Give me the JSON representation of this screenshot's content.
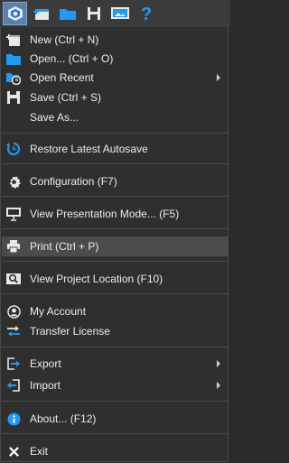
{
  "toolbar": {
    "buttons": [
      {
        "icon": "app-logo-icon",
        "active": true
      },
      {
        "icon": "new-project-icon"
      },
      {
        "icon": "open-folder-icon"
      },
      {
        "icon": "save-icon"
      },
      {
        "icon": "presentation-icon"
      },
      {
        "icon": "help-icon"
      }
    ]
  },
  "menu": {
    "new": "New (Ctrl + N)",
    "open": "Open... (Ctrl + O)",
    "open_recent": "Open Recent",
    "save": "Save (Ctrl + S)",
    "save_as": "Save As...",
    "restore_autosave": "Restore Latest Autosave",
    "configuration": "Configuration (F7)",
    "presentation_mode": "View Presentation Mode... (F5)",
    "print": "Print (Ctrl + P)",
    "project_location": "View Project Location (F10)",
    "my_account": "My Account",
    "transfer_license": "Transfer License",
    "export": "Export",
    "import": "Import",
    "about": "About... (F12)",
    "exit": "Exit"
  },
  "colors": {
    "accent_blue": "#1e9bf0",
    "highlight": "#4b4b4b",
    "menu_bg": "#2f2f2f",
    "text": "#ececec"
  }
}
